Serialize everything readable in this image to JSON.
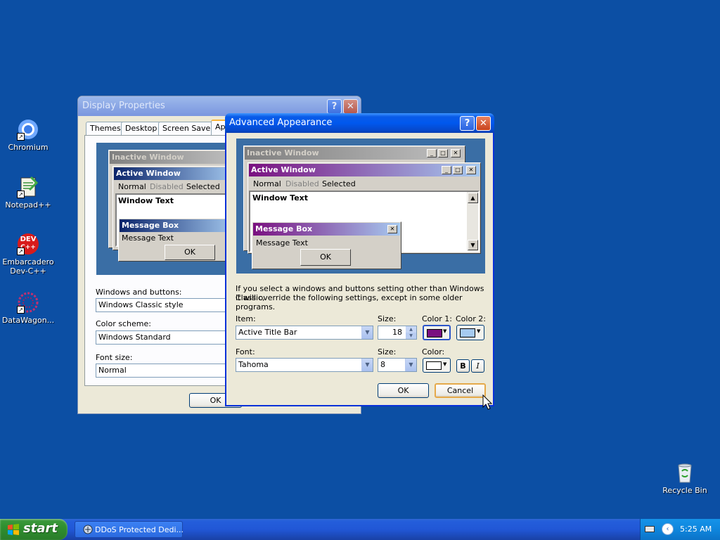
{
  "desktop": {
    "icons": [
      {
        "label_line1": "Chromium",
        "label_line2": ""
      },
      {
        "label_line1": "Notepad++",
        "label_line2": ""
      },
      {
        "label_line1": "Embarcadero",
        "label_line2": "Dev-C++"
      },
      {
        "label_line1": "DataWagon...",
        "label_line2": ""
      }
    ],
    "recycle_bin": "Recycle Bin",
    "dev_icon_text": "DEV",
    "dev_icon_sub": "C++"
  },
  "display_properties": {
    "title": "Display Properties",
    "tabs": [
      "Themes",
      "Desktop",
      "Screen Saver",
      "Ap"
    ],
    "preview": {
      "inactive": "Inactive Window",
      "active": "Active Window",
      "menu_normal": "Normal",
      "menu_disabled": "Disabled",
      "menu_selected": "Selected",
      "window_text": "Window Text",
      "msgbox_title": "Message Box",
      "msgbox_text": "Message Text",
      "ok": "OK"
    },
    "windows_buttons_label": "Windows and buttons:",
    "windows_buttons_value": "Windows Classic style",
    "color_scheme_label": "Color scheme:",
    "color_scheme_value": "Windows Standard",
    "font_size_label": "Font size:",
    "font_size_value": "Normal",
    "ok": "OK"
  },
  "advanced": {
    "title": "Advanced Appearance",
    "preview": {
      "inactive": "Inactive Window",
      "active": "Active Window",
      "menu_normal": "Normal",
      "menu_disabled": "Disabled",
      "menu_selected": "Selected",
      "window_text": "Window Text",
      "msgbox_title": "Message Box",
      "msgbox_text": "Message Text",
      "ok": "OK"
    },
    "info_line1": "If you select a windows and buttons setting other than Windows Classic,",
    "info_line2": "it will override the following settings, except in some older programs.",
    "item_label": "Item:",
    "item_value": "Active Title Bar",
    "size_label": "Size:",
    "size_value": "18",
    "color1_label": "Color 1:",
    "color2_label": "Color 2:",
    "font_label": "Font:",
    "font_value": "Tahoma",
    "font_size_label": "Size:",
    "font_size_value": "8",
    "color_label": "Color:",
    "bold": "B",
    "italic": "I",
    "ok": "OK",
    "cancel": "Cancel",
    "color1_hex": "#7a1080",
    "color2_hex": "#a6caf0"
  },
  "taskbar": {
    "start": "start",
    "task_item": "DDoS Protected Dedi...",
    "clock": "5:25 AM"
  },
  "colors": {
    "desktop": "#0c4fa4",
    "active_title_start": "#7a1080",
    "active_title_end": "#a6caf0",
    "inactive_title": "#808080",
    "classic_active_start": "#0a246a",
    "classic_active_end": "#a6caf0"
  }
}
